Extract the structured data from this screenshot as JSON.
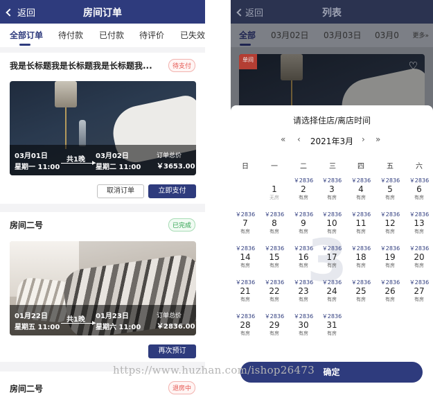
{
  "left": {
    "back_label": "返回",
    "title": "房间订单",
    "tabs": [
      "全部订单",
      "待付款",
      "已付款",
      "待评价",
      "已失效"
    ],
    "orders": [
      {
        "title": "我是长标题我是长标题我是长标题我...",
        "status": "待支付",
        "checkin_date": "03月01日",
        "checkin_time": "星期一 11:00",
        "nights": "共1晚",
        "checkout_date": "03月02日",
        "checkout_time": "星期二 11:00",
        "total_label": "订单总价",
        "total": "￥3653.00",
        "buttons": [
          "取消订单",
          "立即支付"
        ]
      },
      {
        "title": "房间二号",
        "status": "已完成",
        "checkin_date": "01月22日",
        "checkin_time": "星期五 11:00",
        "nights": "共1晚",
        "checkout_date": "01月23日",
        "checkout_time": "星期六 11:00",
        "total_label": "订单总价",
        "total": "￥2836.00",
        "buttons": [
          "再次预订"
        ]
      },
      {
        "title": "房间二号",
        "status": "退房中"
      }
    ]
  },
  "right": {
    "back_label": "返回",
    "title": "列表",
    "tabs": [
      "全部",
      "03月02日",
      "03月03日",
      "03月0"
    ],
    "more": "更多»",
    "corner_tag": "单间",
    "sheet_title": "请选择住店/离店时间",
    "month": "2021年3月",
    "weekdays": [
      "日",
      "一",
      "二",
      "三",
      "四",
      "五",
      "六"
    ],
    "big_month_watermark": "3",
    "confirm": "确定",
    "calendar": [
      {
        "day": "1",
        "price": "",
        "status": "无房"
      },
      {
        "day": "2",
        "price": "￥2836",
        "status": "有房"
      },
      {
        "day": "3",
        "price": "￥2836",
        "status": "有房"
      },
      {
        "day": "4",
        "price": "￥2836",
        "status": "有房"
      },
      {
        "day": "5",
        "price": "￥2836",
        "status": "有房"
      },
      {
        "day": "6",
        "price": "￥2836",
        "status": "有房"
      },
      {
        "day": "7",
        "price": "￥2836",
        "status": "有房"
      },
      {
        "day": "8",
        "price": "￥2836",
        "status": "有房"
      },
      {
        "day": "9",
        "price": "￥2836",
        "status": "有房"
      },
      {
        "day": "10",
        "price": "￥2836",
        "status": "有房"
      },
      {
        "day": "11",
        "price": "￥2836",
        "status": "有房"
      },
      {
        "day": "12",
        "price": "￥2836",
        "status": "有房"
      },
      {
        "day": "13",
        "price": "￥2836",
        "status": "有房"
      },
      {
        "day": "14",
        "price": "￥2836",
        "status": "有房"
      },
      {
        "day": "15",
        "price": "￥2836",
        "status": "有房"
      },
      {
        "day": "16",
        "price": "￥2836",
        "status": "有房"
      },
      {
        "day": "17",
        "price": "￥2836",
        "status": "有房"
      },
      {
        "day": "18",
        "price": "￥2836",
        "status": "有房"
      },
      {
        "day": "19",
        "price": "￥2836",
        "status": "有房"
      },
      {
        "day": "20",
        "price": "￥2836",
        "status": "有房"
      },
      {
        "day": "21",
        "price": "￥2836",
        "status": "有房"
      },
      {
        "day": "22",
        "price": "￥2836",
        "status": "有房"
      },
      {
        "day": "23",
        "price": "￥2836",
        "status": "有房"
      },
      {
        "day": "24",
        "price": "￥2836",
        "status": "有房"
      },
      {
        "day": "25",
        "price": "￥2836",
        "status": "有房"
      },
      {
        "day": "26",
        "price": "￥2836",
        "status": "有房"
      },
      {
        "day": "27",
        "price": "￥2836",
        "status": "有房"
      },
      {
        "day": "28",
        "price": "￥2836",
        "status": "有房"
      },
      {
        "day": "29",
        "price": "￥2836",
        "status": "有房"
      },
      {
        "day": "30",
        "price": "￥2836",
        "status": "有房"
      },
      {
        "day": "31",
        "price": "￥2836",
        "status": "有房"
      }
    ]
  },
  "watermark_url": "https://www.huzhan.com/ishop26473",
  "colors": {
    "primary": "#2e3b7d",
    "paid_red": "#e4544e",
    "done_green": "#2aa04c"
  }
}
